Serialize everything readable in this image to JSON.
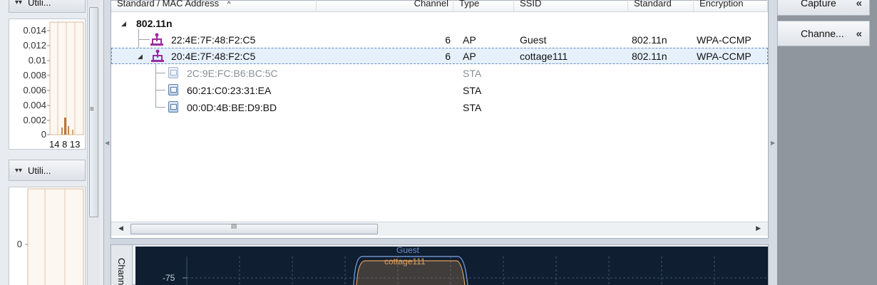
{
  "left_panel": {
    "sections": [
      {
        "label": "Utili...",
        "chevron": "collapse-chevron-icon"
      },
      {
        "label": "Utili...",
        "chevron": "collapse-chevron-icon"
      }
    ],
    "chart1": {
      "y_ticks": [
        "0.014",
        "0.012",
        "0.01",
        "0.008",
        "0.006",
        "0.004",
        "0.002",
        "0"
      ],
      "x_ticks": "14 8 13"
    },
    "chart2": {
      "y_ticks": [
        "0"
      ]
    }
  },
  "table": {
    "headers": [
      "Standard / MAC Address",
      "Channel",
      "Type",
      "SSID",
      "Standard",
      "Encryption"
    ],
    "sort_indicator": "^",
    "group": "802.11n",
    "rows": [
      {
        "mac": "22:4E:7F:48:F2:C5",
        "channel": "6",
        "type": "AP",
        "ssid": "Guest",
        "standard": "802.11n",
        "encryption": "WPA-CCMP"
      },
      {
        "mac": "20:4E:7F:48:F2:C5",
        "channel": "6",
        "type": "AP",
        "ssid": "cottage111",
        "standard": "802.11n",
        "encryption": "WPA-CCMP"
      },
      {
        "mac": "2C:9E:FC:B6:BC:5C",
        "channel": "",
        "type": "STA",
        "ssid": "",
        "standard": "",
        "encryption": ""
      },
      {
        "mac": "60:21:C0:23:31:EA",
        "channel": "",
        "type": "STA",
        "ssid": "",
        "standard": "",
        "encryption": ""
      },
      {
        "mac": "00:0D:4B:BE:D9:BD",
        "channel": "",
        "type": "STA",
        "ssid": "",
        "standard": "",
        "encryption": ""
      }
    ],
    "hscroll_grip": "III"
  },
  "right_panel": {
    "buttons": [
      {
        "label": "Capture",
        "icon": "double-chevron-left-icon"
      },
      {
        "label": "Channe...",
        "icon": "double-chevron-left-icon"
      }
    ]
  },
  "graph": {
    "tab_label": "Chann",
    "y_tick": "-75",
    "networks": [
      "Guest",
      "cottage111"
    ],
    "colors": {
      "background": "#0f1e30",
      "guest": "#6f8fc8",
      "cottage": "#e0a060",
      "grid": "#3f5470"
    }
  }
}
